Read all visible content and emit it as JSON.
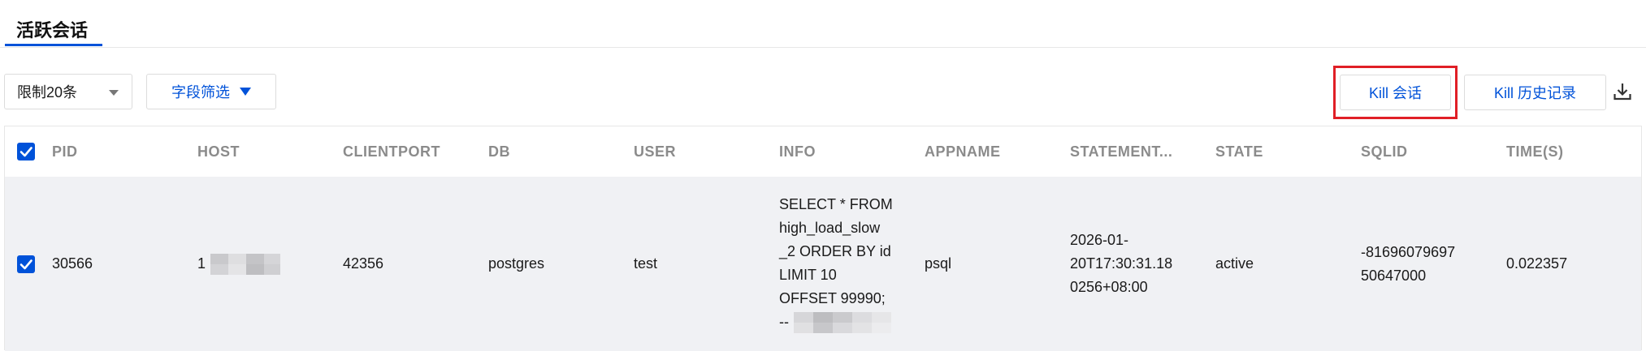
{
  "tabs": {
    "active_label": "活跃会话"
  },
  "toolbar": {
    "limit_select": "限制20条",
    "field_filter": "字段筛选",
    "kill_session": "Kill 会话",
    "kill_history": "Kill 历史记录"
  },
  "table": {
    "columns": [
      "PID",
      "HOST",
      "CLIENTPORT",
      "DB",
      "USER",
      "INFO",
      "APPNAME",
      "STATEMENT...",
      "STATE",
      "SQLID",
      "TIME(S)"
    ],
    "rows": [
      {
        "checked": true,
        "pid": "30566",
        "host_prefix": "1",
        "clientport": "42356",
        "db": "postgres",
        "user": "test",
        "info": "SELECT * FROM\nhigh_load_slow\n_2 ORDER BY id\nLIMIT 10\nOFFSET 99990;",
        "info_tail_prefix": "--",
        "appname": "psql",
        "statement": "2026-01-\n20T17:30:31.18\n0256+08:00",
        "state": "active",
        "sqlid": "-81696079697\n50647000",
        "time": "0.022357"
      }
    ]
  },
  "colors": {
    "accent": "#0052d9",
    "highlight": "#e01f26",
    "row_bg": "#f0f1f4"
  },
  "icons": {
    "download": "download-icon",
    "check": "check-icon",
    "caret": "caret-down-icon"
  }
}
